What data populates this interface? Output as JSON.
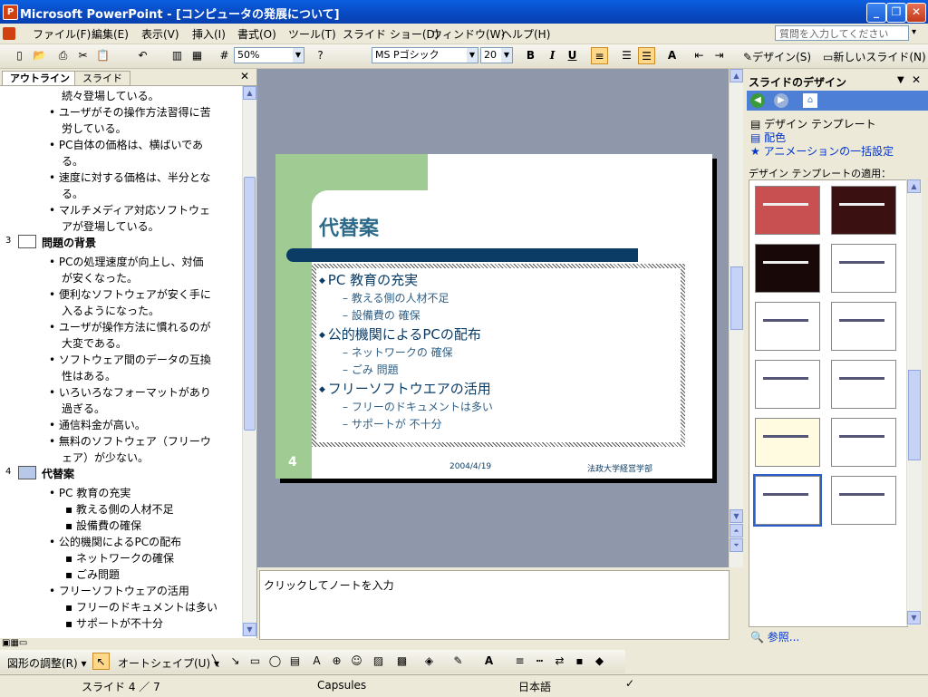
{
  "window": {
    "title": "Microsoft PowerPoint - [コンピュータの発展について]",
    "min": "_",
    "restore": "❐",
    "close": "✕"
  },
  "menu": [
    "ファイル(F)",
    "編集(E)",
    "表示(V)",
    "挿入(I)",
    "書式(O)",
    "ツール(T)",
    "スライド ショー(D)",
    "ウィンドウ(W)",
    "ヘルプ(H)"
  ],
  "help_placeholder": "質問を入力してください",
  "toolbar": {
    "zoom": "50%",
    "font": "MS Pゴシック",
    "size": "20",
    "bold": "B",
    "italic": "I",
    "underline": "U",
    "design_label": "デザイン(S)",
    "new_slide_label": "新しいスライド(N)"
  },
  "outline": {
    "tabs": [
      "アウトライン",
      "スライド"
    ],
    "lines": [
      {
        "t": "続々登場している。",
        "lvl": 2
      },
      {
        "t": "• ユーザがその操作方法習得に苦",
        "lvl": 1
      },
      {
        "t": "労している。",
        "lvl": 2
      },
      {
        "t": "• PC自体の価格は、横ばいであ",
        "lvl": 1
      },
      {
        "t": "る。",
        "lvl": 2
      },
      {
        "t": "• 速度に対する価格は、半分とな",
        "lvl": 1
      },
      {
        "t": "る。",
        "lvl": 2
      },
      {
        "t": "• マルチメディア対応ソフトウェ",
        "lvl": 1
      },
      {
        "t": "アが登場している。",
        "lvl": 2
      },
      {
        "t": "問題の背景",
        "lvl": 0,
        "num": "3"
      },
      {
        "t": "• PCの処理速度が向上し、対価",
        "lvl": 1
      },
      {
        "t": "が安くなった。",
        "lvl": 2
      },
      {
        "t": "• 便利なソフトウェアが安く手に",
        "lvl": 1
      },
      {
        "t": "入るようになった。",
        "lvl": 2
      },
      {
        "t": "• ユーザが操作方法に慣れるのが",
        "lvl": 1
      },
      {
        "t": "大変である。",
        "lvl": 2
      },
      {
        "t": "• ソフトウェア間のデータの互換",
        "lvl": 1
      },
      {
        "t": "性はある。",
        "lvl": 2
      },
      {
        "t": "• いろいろなフォーマットがあり",
        "lvl": 1
      },
      {
        "t": "過ぎる。",
        "lvl": 2
      },
      {
        "t": "• 通信料金が高い。",
        "lvl": 1
      },
      {
        "t": "• 無料のソフトウェア（フリーウ",
        "lvl": 1
      },
      {
        "t": "ェア）が少ない。",
        "lvl": 2
      },
      {
        "t": "代替案",
        "lvl": 0,
        "num": "4"
      },
      {
        "t": "• PC 教育の充実",
        "lvl": 1
      },
      {
        "t": "▪ 教える側の人材不足",
        "lvl": 3
      },
      {
        "t": "▪ 設備費の確保",
        "lvl": 3
      },
      {
        "t": "• 公的機関によるPCの配布",
        "lvl": 1
      },
      {
        "t": "▪ ネットワークの確保",
        "lvl": 3
      },
      {
        "t": "▪ ごみ問題",
        "lvl": 3
      },
      {
        "t": "• フリーソフトウェアの活用",
        "lvl": 1
      },
      {
        "t": "▪ フリーのドキュメントは多い",
        "lvl": 3
      },
      {
        "t": "▪ サポートが不十分",
        "lvl": 3
      }
    ]
  },
  "slide": {
    "title": "代替案",
    "bullets": [
      {
        "t": "PC 教育の充実",
        "lvl": 1
      },
      {
        "t": "教える側の人材不足",
        "lvl": 2
      },
      {
        "t": "設備費の 確保",
        "lvl": 2
      },
      {
        "t": "公的機関によるPCの配布",
        "lvl": 1
      },
      {
        "t": "ネットワークの 確保",
        "lvl": 2
      },
      {
        "t": "ごみ 問題",
        "lvl": 2
      },
      {
        "t": "フリーソフトウエアの活用",
        "lvl": 1
      },
      {
        "t": "フリーのドキュメントは多い",
        "lvl": 2
      },
      {
        "t": "サポートが 不十分",
        "lvl": 2
      }
    ],
    "number": "4",
    "date": "2004/4/19",
    "footer": "法政大学経営学部",
    "green": "#a0cc94",
    "navy": "#0b3c66"
  },
  "notes_placeholder": "クリックしてノートを入力",
  "taskpane": {
    "title": "スライドのデザイン",
    "links": [
      "デザイン テンプレート",
      "配色",
      "アニメーションの一括設定"
    ],
    "apply_label": "デザイン テンプレートの適用：",
    "browse": "参照..."
  },
  "drawbar": {
    "adjust": "図形の調整(R) ▾",
    "autoshape": "オートシェイプ(U) ▾"
  },
  "status": {
    "slide": "スライド 4 ／ 7",
    "template": "Capsules",
    "lang": "日本語"
  }
}
